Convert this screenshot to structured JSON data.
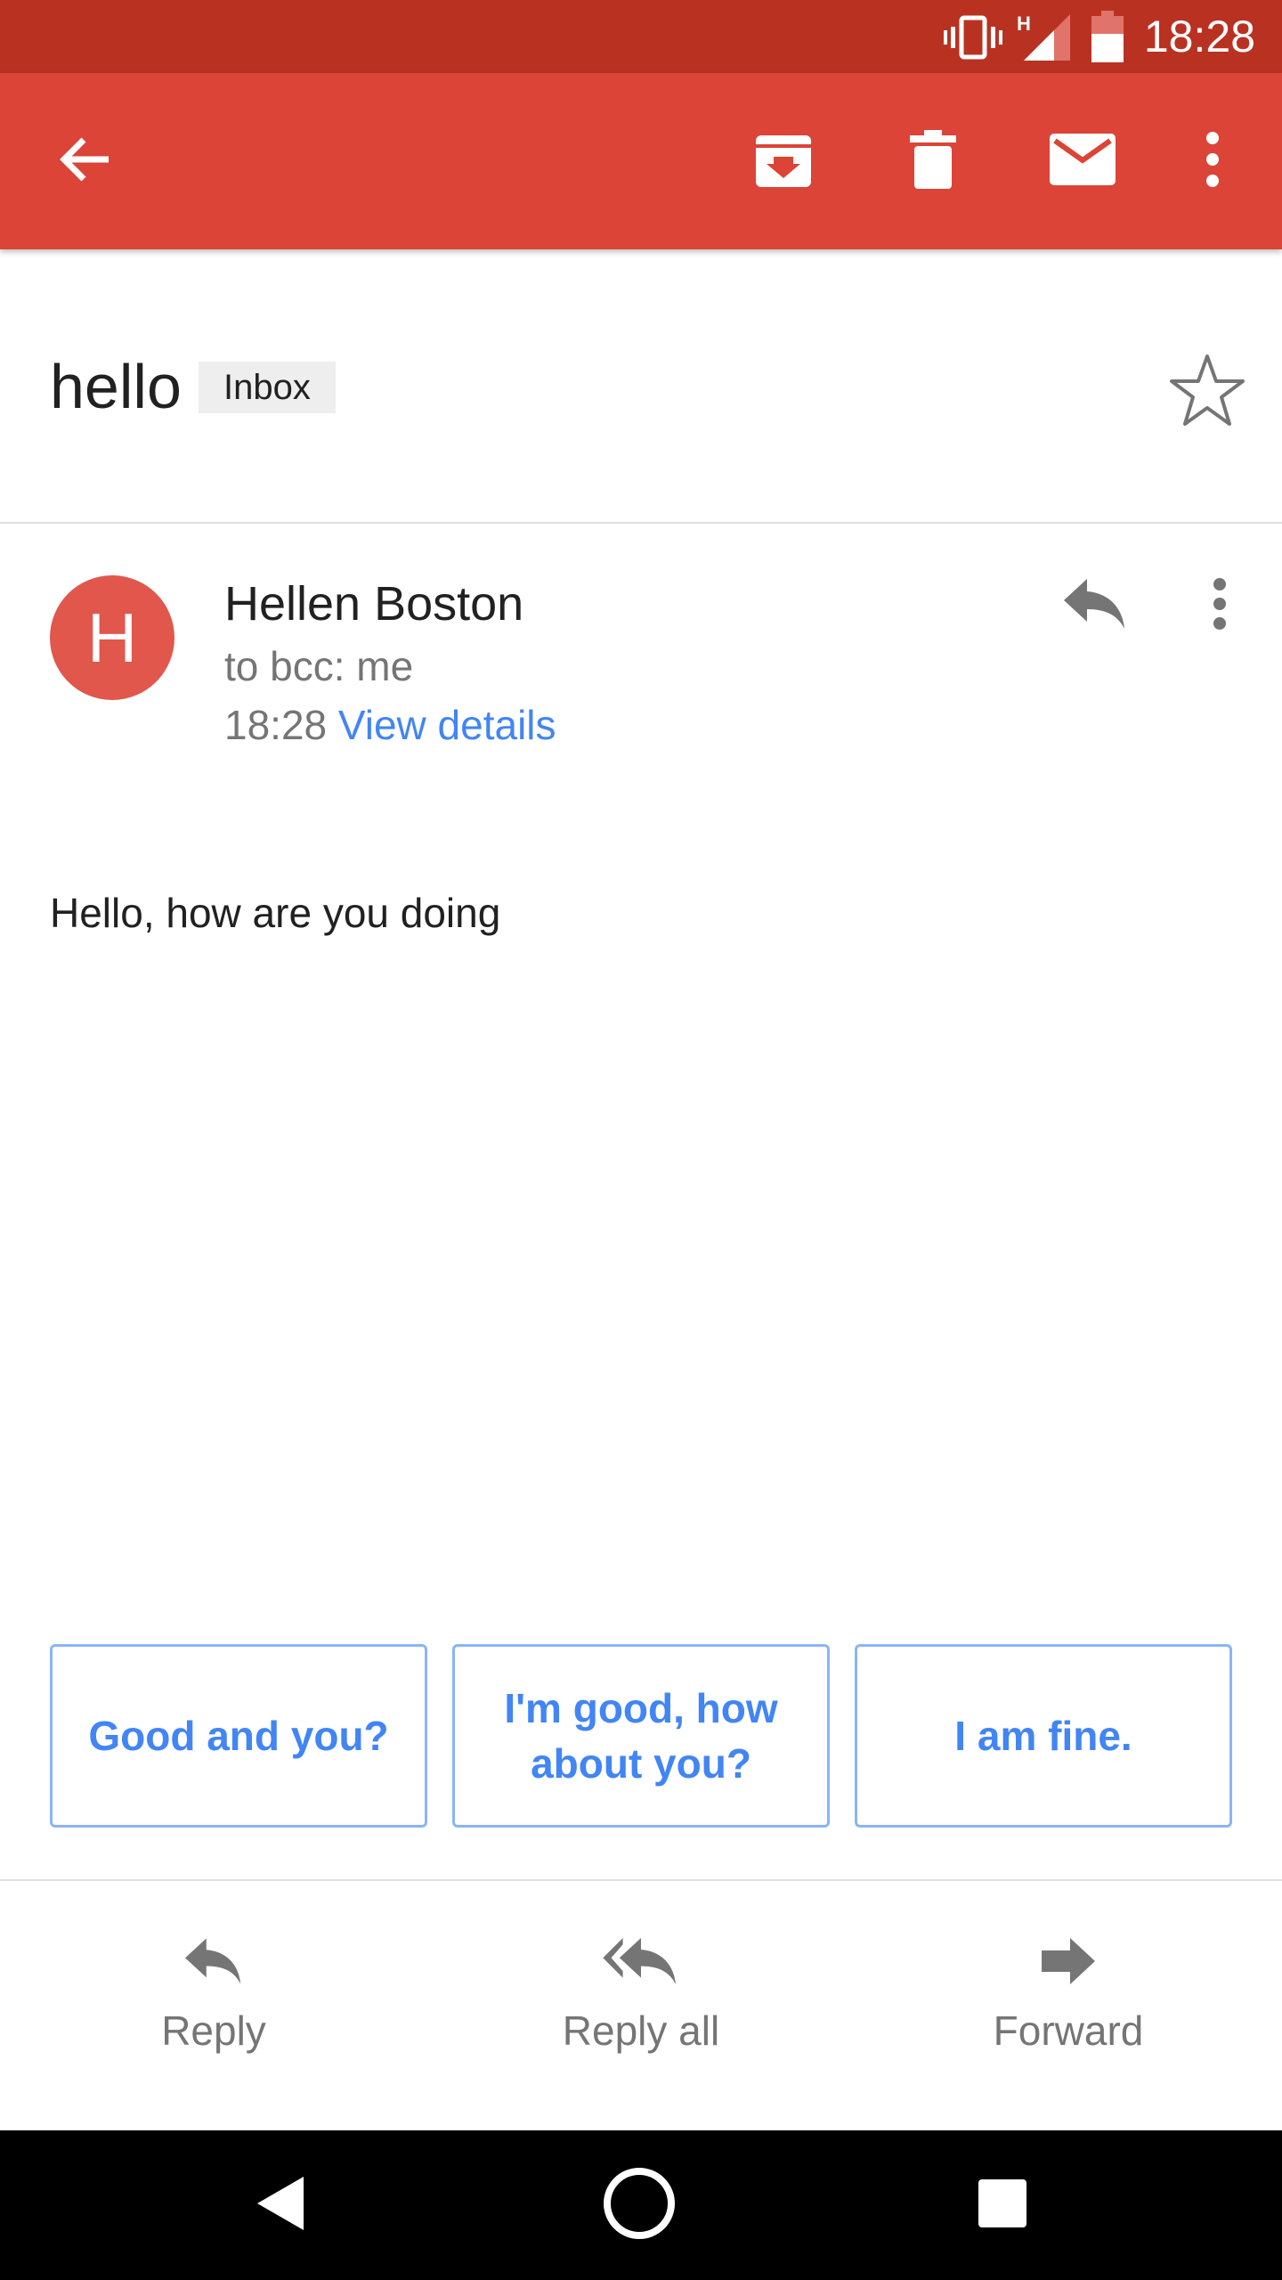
{
  "status_bar": {
    "time": "18:28",
    "network_type": "H",
    "icons": [
      "vibrate-icon",
      "signal-icon",
      "battery-icon"
    ]
  },
  "toolbar": {
    "icons": [
      "back-arrow-icon",
      "archive-icon",
      "delete-icon",
      "mail-icon",
      "more-vert-icon"
    ],
    "color": "#db4437"
  },
  "email": {
    "subject": "hello",
    "label": "Inbox",
    "starred": false,
    "sender_initial": "H",
    "sender_name": "Hellen Boston",
    "recipients": "to bcc: me",
    "time": "18:28",
    "view_details": "View details",
    "body": "Hello, how are you doing"
  },
  "smart_replies": [
    "Good and you?",
    "I'm good, how about you?",
    "I am fine."
  ],
  "actions": {
    "reply": "Reply",
    "reply_all": "Reply all",
    "forward": "Forward"
  },
  "navigation": {
    "icons": [
      "back-triangle-icon",
      "home-circle-icon",
      "recents-square-icon"
    ]
  },
  "colors": {
    "accent": "#4285f4",
    "avatar": "#e1574b",
    "status_bar": "#b93221"
  }
}
